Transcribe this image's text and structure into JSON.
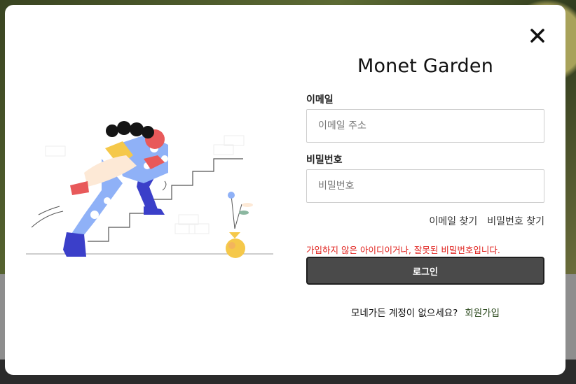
{
  "modal": {
    "brand_title": "Monet Garden",
    "email_label": "이메일",
    "email_placeholder": "이메일 주소",
    "email_value": "",
    "password_label": "비밀번호",
    "password_placeholder": "비밀번호",
    "password_value": "",
    "find_email_link": "이메일 찾기",
    "find_password_link": "비밀번호 찾기",
    "error_message": "가입하지 않은 아이디이거나, 잘못된 비밀번호입니다.",
    "login_button": "로그인",
    "signup_prompt": "모네가든 계정이 없으세요?",
    "signup_link": "회원가입"
  },
  "icons": {
    "close": "close-icon",
    "illustration": "running-up-stairs-illustration"
  },
  "colors": {
    "error": "#e0201c",
    "button_bg": "#4a4a4a",
    "signup_link": "#2c4a1e"
  }
}
